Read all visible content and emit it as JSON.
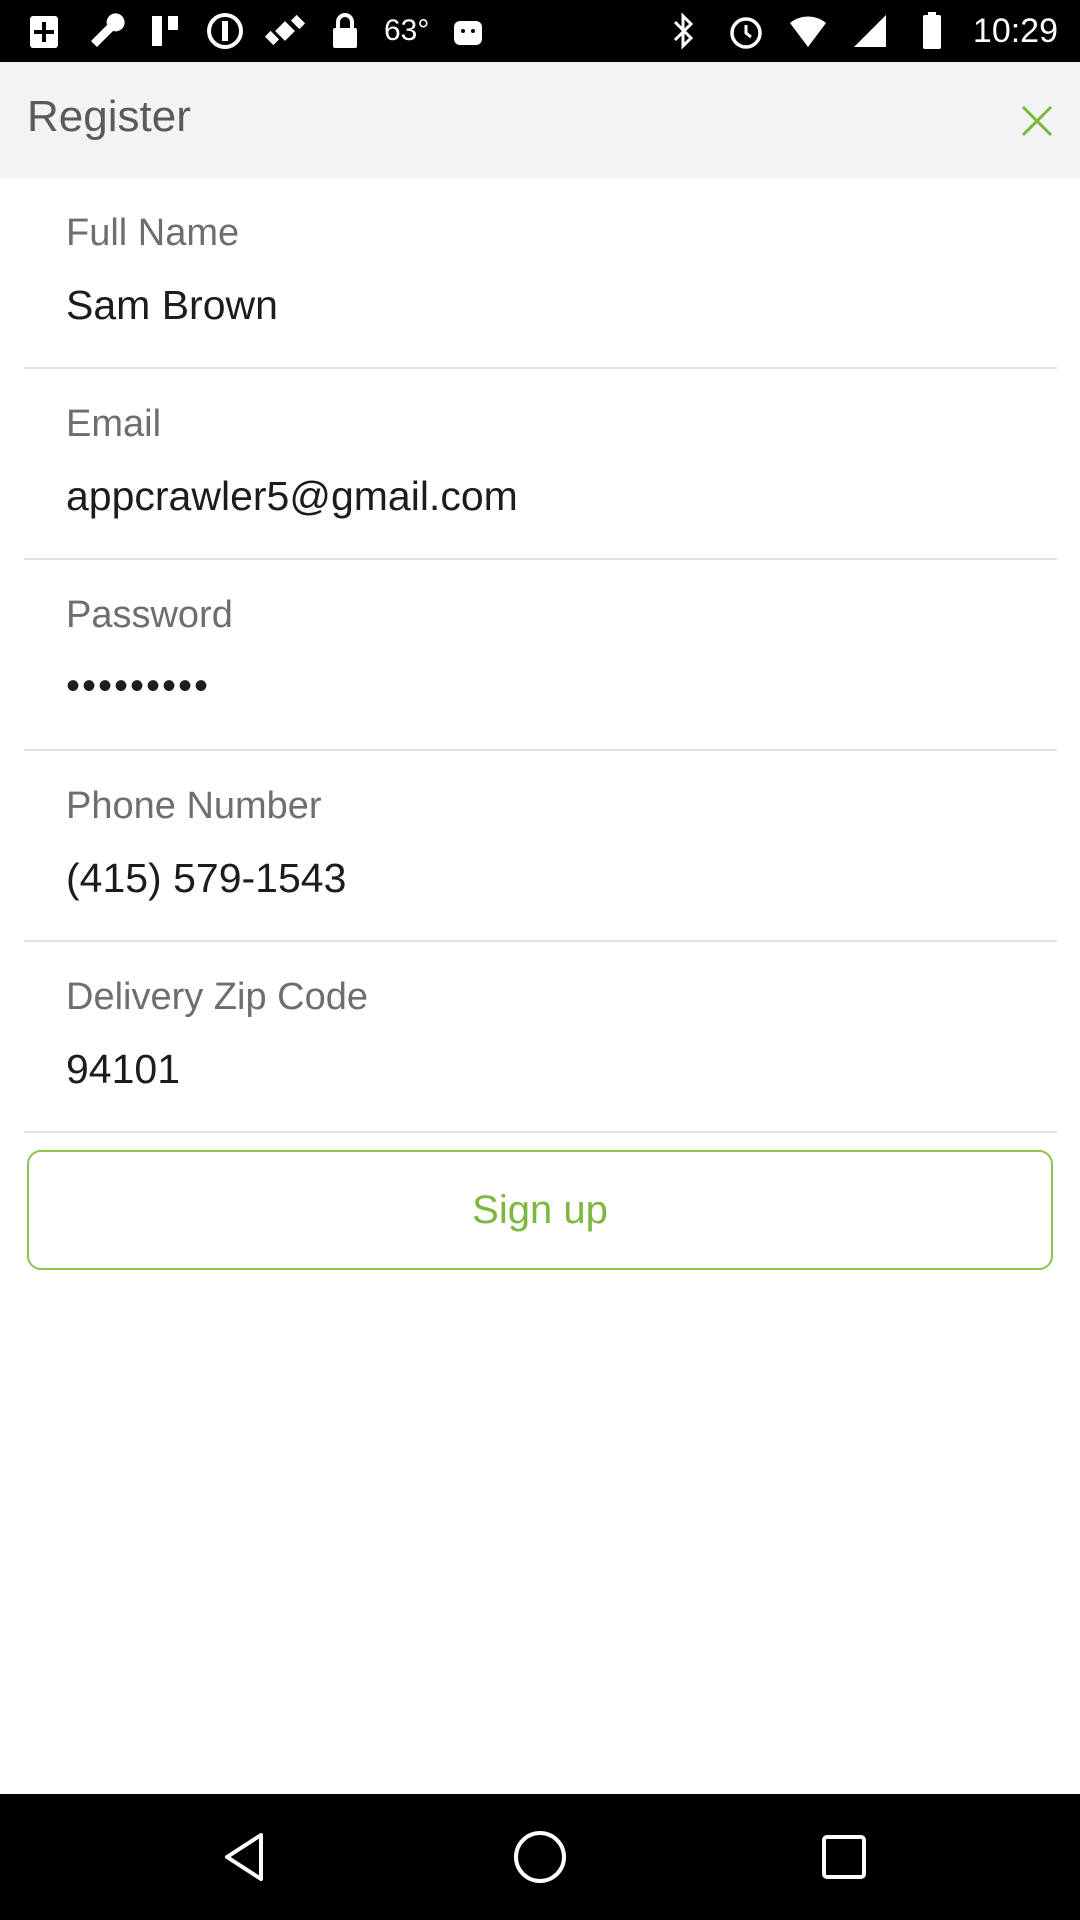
{
  "status_bar": {
    "icons": [
      "add-box-icon",
      "wrench-icon",
      "pause-icon",
      "circle-icon",
      "satellite-fake-icon",
      "lock-icon",
      "android-icon",
      "bluetooth-icon",
      "alarm-icon",
      "wifi-icon",
      "cellular-icon",
      "battery-icon"
    ],
    "temperature": "63°",
    "time": "10:29"
  },
  "header": {
    "title": "Register",
    "close_icon": "close-icon",
    "accent_color": "#7db73e"
  },
  "form": {
    "fields": [
      {
        "label": "Full Name",
        "value": "Sam Brown"
      },
      {
        "label": "Email",
        "value": "appcrawler5@gmail.com"
      },
      {
        "label": "Password",
        "value": "•••••••••"
      },
      {
        "label": "Phone Number",
        "value": "(415) 579-1543"
      },
      {
        "label": "Delivery Zip Code",
        "value": "94101"
      }
    ],
    "submit_label": "Sign up"
  },
  "nav_bar": {
    "icons": [
      "back-icon",
      "home-icon",
      "recents-icon"
    ]
  }
}
